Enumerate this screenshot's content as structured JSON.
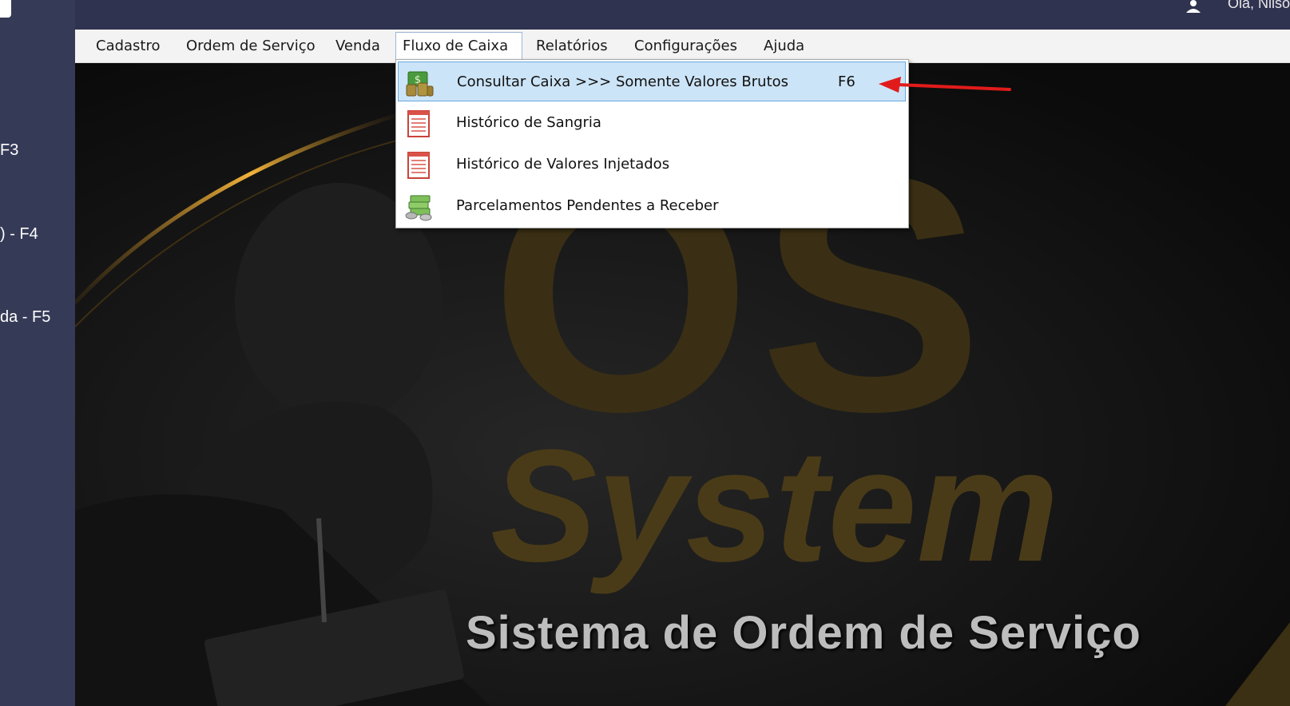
{
  "header": {
    "greeting": "Olá, Nilso"
  },
  "sidebar": {
    "shortcuts": [
      {
        "label": "F3"
      },
      {
        "label": ") - F4"
      },
      {
        "label": "da - F5"
      }
    ]
  },
  "menubar": {
    "items": [
      {
        "label": "Cadastro"
      },
      {
        "label": "Ordem de Serviço"
      },
      {
        "label": "Venda"
      },
      {
        "label": "Fluxo de Caixa"
      },
      {
        "label": "Relatórios"
      },
      {
        "label": "Configurações"
      },
      {
        "label": "Ajuda"
      }
    ],
    "active_index": 3
  },
  "dropdown": {
    "items": [
      {
        "label": "Consultar Caixa >>> Somente Valores Brutos",
        "shortcut": "F6",
        "icon": "money-stack-icon",
        "highlighted": true
      },
      {
        "label": "Histórico de Sangria",
        "shortcut": "",
        "icon": "report-list-icon"
      },
      {
        "label": "Histórico de Valores Injetados",
        "shortcut": "",
        "icon": "report-list-icon"
      },
      {
        "label": "Parcelamentos Pendentes a Receber",
        "shortcut": "",
        "icon": "cash-coins-icon"
      }
    ]
  },
  "brand": {
    "logo_top": "OS",
    "logo_word": "System",
    "subtitle": "Sistema de Ordem de Serviço"
  },
  "colors": {
    "sidebar": "#353a57",
    "menubar": "#f3f3f3",
    "highlight": "#cce4f7",
    "highlight_border": "#6aa9e0",
    "annotation_arrow": "#e11b1b",
    "logo_gold": "#4a3b18"
  }
}
